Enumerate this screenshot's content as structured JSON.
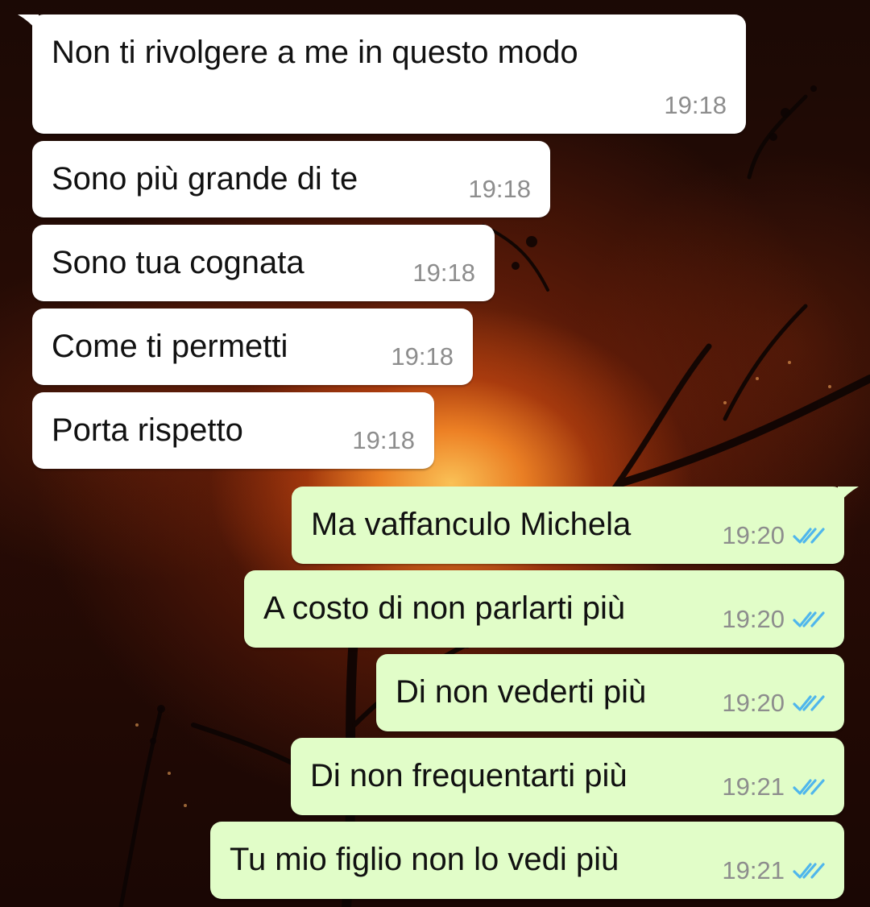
{
  "conversation": {
    "incoming": [
      {
        "text": "Non ti rivolgere a me in questo modo",
        "time": "19:18"
      },
      {
        "text": "Sono più grande di te",
        "time": "19:18"
      },
      {
        "text": "Sono tua cognata",
        "time": "19:18"
      },
      {
        "text": "Come ti permetti",
        "time": "19:18"
      },
      {
        "text": "Porta rispetto",
        "time": "19:18"
      }
    ],
    "outgoing": [
      {
        "text": "Ma vaffanculo Michela",
        "time": "19:20",
        "status": "read"
      },
      {
        "text": "A costo di non parlarti più",
        "time": "19:20",
        "status": "read"
      },
      {
        "text": "Di non vederti più",
        "time": "19:20",
        "status": "read"
      },
      {
        "text": "Di non frequentarti più",
        "time": "19:21",
        "status": "read"
      },
      {
        "text": "Tu mio figlio non lo vedi più",
        "time": "19:21",
        "status": "read"
      }
    ]
  },
  "theme": {
    "incoming_bubble": "#ffffff",
    "outgoing_bubble": "#e1fdc8",
    "read_ticks": "#4fb6ec",
    "timestamp": "#8d8d8d"
  },
  "icons": {
    "read_receipt": "double-check-icon"
  }
}
